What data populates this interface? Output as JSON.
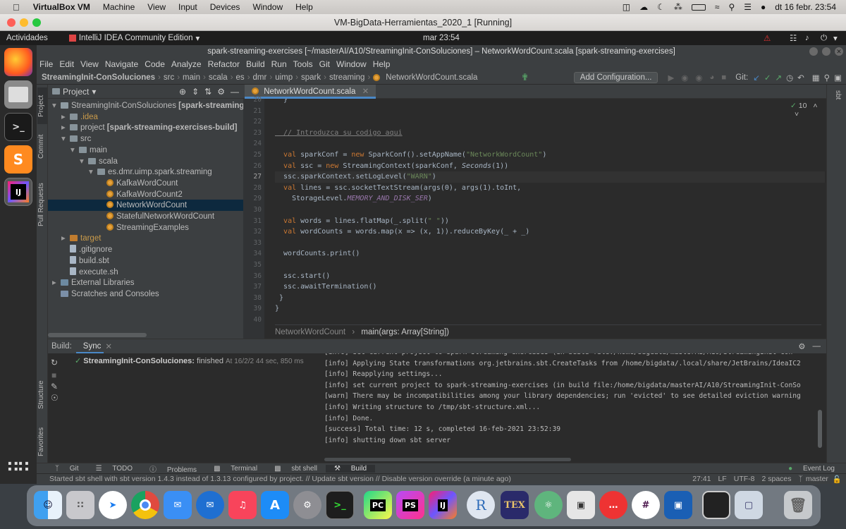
{
  "mac_menubar": {
    "app_name": "VirtualBox VM",
    "items": [
      "Machine",
      "View",
      "Input",
      "Devices",
      "Window",
      "Help"
    ],
    "clock": "dt 16 febr. 23:54"
  },
  "vm_window": {
    "title": "VM-BigData-Herramientas_2020_1 [Running]"
  },
  "gnome_bar": {
    "activities": "Actividades",
    "app_label": "IntelliJ IDEA Community Edition",
    "clock": "mar 23:54"
  },
  "ij_title": "spark-streaming-exercises [~/masterAI/A10/StreamingInit-ConSoluciones] – NetworkWordCount.scala [spark-streaming-exercises]",
  "menu": [
    "File",
    "Edit",
    "View",
    "Navigate",
    "Code",
    "Analyze",
    "Refactor",
    "Build",
    "Run",
    "Tools",
    "Git",
    "Window",
    "Help"
  ],
  "breadcrumbs": [
    "StreamingInit-ConSoluciones",
    "src",
    "main",
    "scala",
    "es",
    "dmr",
    "uimp",
    "spark",
    "streaming",
    "NetworkWordCount.scala"
  ],
  "add_config": "Add Configuration...",
  "git_label": "Git:",
  "left_tabs": {
    "project": "Project",
    "commit": "Commit",
    "pull": "Pull Requests",
    "structure": "Structure",
    "favorites": "Favorites"
  },
  "right_tabs": {
    "sbt": "sbt"
  },
  "project_panel": {
    "title": "Project",
    "tree": [
      {
        "label": "StreamingInit-ConSoluciones",
        "extra": " [spark-streaming-",
        "icon": "folder",
        "indent": 0,
        "arrow": "▾"
      },
      {
        "label": ".idea",
        "extra": "",
        "icon": "folder",
        "indent": 1,
        "arrow": "▸"
      },
      {
        "label": "project",
        "extra": " [spark-streaming-exercises-build]",
        "icon": "folder",
        "indent": 1,
        "arrow": "▸"
      },
      {
        "label": "src",
        "extra": "",
        "icon": "folder",
        "indent": 1,
        "arrow": "▾"
      },
      {
        "label": "main",
        "extra": "",
        "icon": "folder",
        "indent": 2,
        "arrow": "▾"
      },
      {
        "label": "scala",
        "extra": "",
        "icon": "folder",
        "indent": 3,
        "arrow": "▾"
      },
      {
        "label": "es.dmr.uimp.spark.streaming",
        "extra": "",
        "icon": "folder",
        "indent": 4,
        "arrow": "▾"
      },
      {
        "label": "KafkaWordCount",
        "extra": "",
        "icon": "object",
        "indent": 5,
        "arrow": ""
      },
      {
        "label": "KafkaWordCount2",
        "extra": "",
        "icon": "object",
        "indent": 5,
        "arrow": ""
      },
      {
        "label": "NetworkWordCount",
        "extra": "",
        "icon": "object",
        "indent": 5,
        "arrow": ""
      },
      {
        "label": "StatefulNetworkWordCount",
        "extra": "",
        "icon": "object",
        "indent": 5,
        "arrow": ""
      },
      {
        "label": "StreamingExamples",
        "extra": "",
        "icon": "object",
        "indent": 5,
        "arrow": ""
      },
      {
        "label": "target",
        "extra": "",
        "icon": "folder-orange",
        "indent": 1,
        "arrow": "▸"
      },
      {
        "label": ".gitignore",
        "extra": "",
        "icon": "file",
        "indent": 1,
        "arrow": ""
      },
      {
        "label": "build.sbt",
        "extra": "",
        "icon": "file",
        "indent": 1,
        "arrow": ""
      },
      {
        "label": "execute.sh",
        "extra": "",
        "icon": "file",
        "indent": 1,
        "arrow": ""
      },
      {
        "label": "External Libraries",
        "extra": "",
        "icon": "lib",
        "indent": 0,
        "arrow": "▸"
      },
      {
        "label": "Scratches and Consoles",
        "extra": "",
        "icon": "scratch",
        "indent": 0,
        "arrow": ""
      }
    ],
    "selected_index": 9
  },
  "editor": {
    "tab": "NetworkWordCount.scala",
    "inspection_count": "10",
    "first_line": 20,
    "current_line": 27,
    "lines": [
      "  }",
      "",
      "",
      "  // Introduzca su codigo aqui",
      "",
      "  val sparkConf = new SparkConf().setAppName(\"NetworkWordCount\")",
      "  val ssc = new StreamingContext(sparkConf, Seconds(1))",
      "  ssc.sparkContext.setLogLevel(\"WARN\")",
      "  val lines = ssc.socketTextStream(args(0), args(1).toInt,",
      "    StorageLevel.MEMORY_AND_DISK_SER)",
      "",
      "  val words = lines.flatMap(_.split(\" \"))",
      "  val wordCounts = words.map(x => (x, 1)).reduceByKey(_ + _)",
      "",
      "  wordCounts.print()",
      "",
      "  ssc.start()",
      "  ssc.awaitTermination()",
      " }",
      "}",
      ""
    ],
    "bottom_breadcrumb": [
      "NetworkWordCount",
      "main(args: Array[String])"
    ]
  },
  "build_panel": {
    "tabs": [
      "Build:",
      "Sync"
    ],
    "tree_item": "StreamingInit-ConSoluciones:",
    "tree_status": "finished",
    "tree_time": "At 16/2/2 44 sec, 850 ms",
    "log": [
      "[info] set current project to spark-streaming-exercises (in build file:/home/bigdata/masterAI/A10/StreamingInit-Con",
      "[info] Applying State transformations org.jetbrains.sbt.CreateTasks from /home/bigdata/.local/share/JetBrains/IdeaIC2",
      "[info] Reapplying settings...",
      "[info] set current project to spark-streaming-exercises (in build file:/home/bigdata/masterAI/A10/StreamingInit-ConSo",
      "[warn] There may be incompatibilities among your library dependencies; run 'evicted' to see detailed eviction warning",
      "[info] Writing structure to /tmp/sbt-structure.xml...",
      "[info] Done.",
      "[success] Total time: 12 s, completed 16-feb-2021 23:52:39",
      "[info] shutting down sbt server"
    ]
  },
  "bottom_tools": [
    "Git",
    "TODO",
    "Problems",
    "Terminal",
    "sbt shell",
    "Build"
  ],
  "event_log": "Event Log",
  "status": {
    "message": "Started sbt shell with sbt version 1.4.3 instead of 1.3.13 configured by project. // Update sbt version // Disable version override (a minute ago)",
    "position": "27:41",
    "line_sep": "LF",
    "encoding": "UTF-8",
    "indent": "2 spaces",
    "branch": "master"
  },
  "dock_apps": [
    "Finder",
    "Launchpad",
    "Safari",
    "Chrome",
    "Mail",
    "Thunderbird",
    "Music",
    "App Store",
    "System Preferences",
    "Terminal",
    "PyCharm",
    "PhpStorm",
    "IntelliJ IDEA",
    "R",
    "TeXShop",
    "Atom",
    "Screenshot",
    "Speech",
    "Slack",
    "VirtualBox",
    "Screen",
    "Preview",
    "Trash"
  ]
}
